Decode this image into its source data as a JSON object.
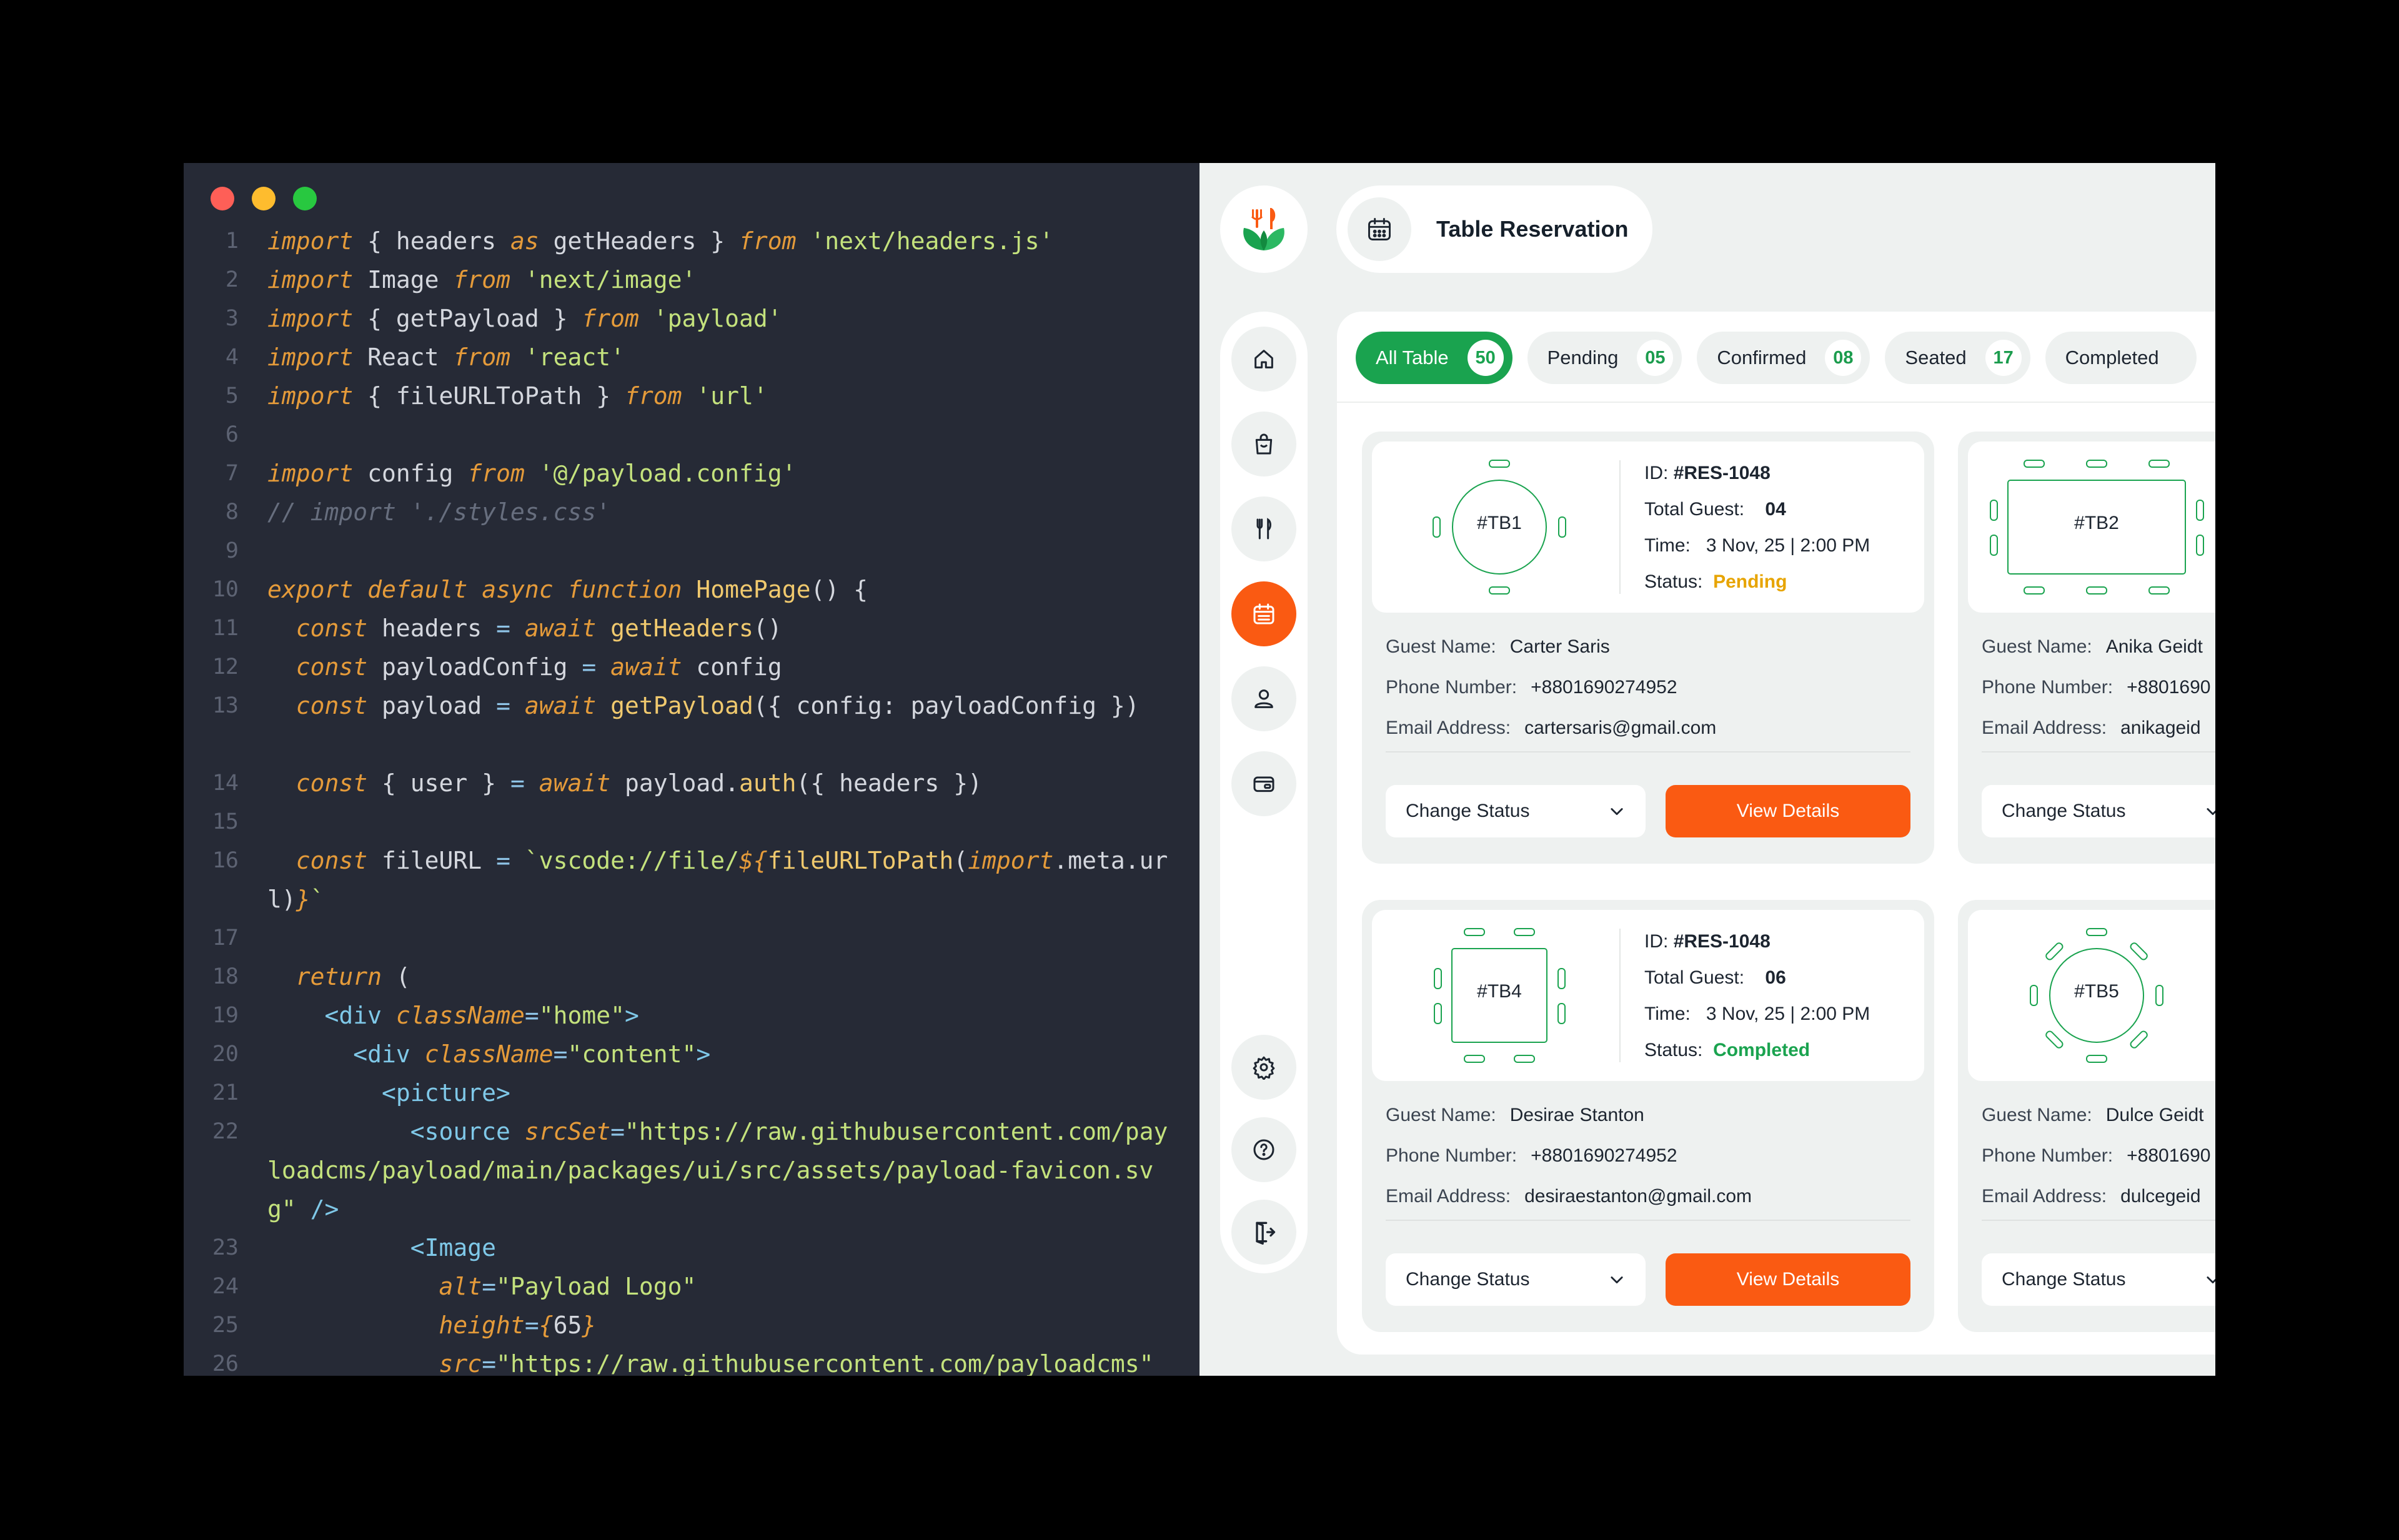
{
  "window_controls": {
    "close_color": "#fe5f57",
    "minimize_color": "#febc2e",
    "maximize_color": "#28c840"
  },
  "editor": {
    "lines": [
      {
        "n": "1",
        "tokens": [
          [
            "kw",
            "import"
          ],
          [
            "p",
            " { headers "
          ],
          [
            "kw",
            "as"
          ],
          [
            "p",
            " getHeaders } "
          ],
          [
            "kw",
            "from"
          ],
          [
            "p",
            " "
          ],
          [
            "str",
            "'next/headers.js'"
          ]
        ]
      },
      {
        "n": "2",
        "tokens": [
          [
            "kw",
            "import"
          ],
          [
            "p",
            " Image "
          ],
          [
            "kw",
            "from"
          ],
          [
            "p",
            " "
          ],
          [
            "str",
            "'next/image'"
          ]
        ]
      },
      {
        "n": "3",
        "tokens": [
          [
            "kw",
            "import"
          ],
          [
            "p",
            " { getPayload } "
          ],
          [
            "kw",
            "from"
          ],
          [
            "p",
            " "
          ],
          [
            "str",
            "'payload'"
          ]
        ]
      },
      {
        "n": "4",
        "tokens": [
          [
            "kw",
            "import"
          ],
          [
            "p",
            " React "
          ],
          [
            "kw",
            "from"
          ],
          [
            "p",
            " "
          ],
          [
            "str",
            "'react'"
          ]
        ]
      },
      {
        "n": "5",
        "tokens": [
          [
            "kw",
            "import"
          ],
          [
            "p",
            " { fileURLToPath } "
          ],
          [
            "kw",
            "from"
          ],
          [
            "p",
            " "
          ],
          [
            "str",
            "'url'"
          ]
        ]
      },
      {
        "n": "6",
        "tokens": []
      },
      {
        "n": "7",
        "tokens": [
          [
            "kw",
            "import"
          ],
          [
            "p",
            " config "
          ],
          [
            "kw",
            "from"
          ],
          [
            "p",
            " "
          ],
          [
            "str",
            "'@/payload.config'"
          ]
        ]
      },
      {
        "n": "8",
        "tokens": [
          [
            "cm",
            "// import './styles.css'"
          ]
        ]
      },
      {
        "n": "9",
        "tokens": []
      },
      {
        "n": "10",
        "tokens": [
          [
            "kw",
            "export"
          ],
          [
            "p",
            " "
          ],
          [
            "kw",
            "default"
          ],
          [
            "p",
            " "
          ],
          [
            "kw",
            "async"
          ],
          [
            "p",
            " "
          ],
          [
            "kw",
            "function"
          ],
          [
            "p",
            " "
          ],
          [
            "fn",
            "HomePage"
          ],
          [
            "p",
            "() {"
          ]
        ]
      },
      {
        "n": "11",
        "tokens": [
          [
            "p",
            "  "
          ],
          [
            "kw",
            "const"
          ],
          [
            "p",
            " headers "
          ],
          [
            "op",
            "="
          ],
          [
            "p",
            " "
          ],
          [
            "kw",
            "await"
          ],
          [
            "p",
            " "
          ],
          [
            "fn",
            "getHeaders"
          ],
          [
            "p",
            "()"
          ]
        ]
      },
      {
        "n": "12",
        "tokens": [
          [
            "p",
            "  "
          ],
          [
            "kw",
            "const"
          ],
          [
            "p",
            " payloadConfig "
          ],
          [
            "op",
            "="
          ],
          [
            "p",
            " "
          ],
          [
            "kw",
            "await"
          ],
          [
            "p",
            " config"
          ]
        ]
      },
      {
        "n": "13",
        "wrap": 2,
        "tokens": [
          [
            "p",
            "  "
          ],
          [
            "kw",
            "const"
          ],
          [
            "p",
            " payload "
          ],
          [
            "op",
            "="
          ],
          [
            "p",
            " "
          ],
          [
            "kw",
            "await"
          ],
          [
            "p",
            " "
          ],
          [
            "fn",
            "getPayload"
          ],
          [
            "p",
            "({ config: payloadConfig })"
          ]
        ]
      },
      {
        "n": "14",
        "tokens": [
          [
            "p",
            "  "
          ],
          [
            "kw",
            "const"
          ],
          [
            "p",
            " { user } "
          ],
          [
            "op",
            "="
          ],
          [
            "p",
            " "
          ],
          [
            "kw",
            "await"
          ],
          [
            "p",
            " payload."
          ],
          [
            "fn",
            "auth"
          ],
          [
            "p",
            "({ headers })"
          ]
        ]
      },
      {
        "n": "15",
        "tokens": []
      },
      {
        "n": "16",
        "wrap": 2,
        "tokens": [
          [
            "p",
            "  "
          ],
          [
            "kw",
            "const"
          ],
          [
            "p",
            " fileURL "
          ],
          [
            "op",
            "="
          ],
          [
            "p",
            " "
          ],
          [
            "str",
            "`vscode://file/"
          ],
          [
            "kw",
            "${"
          ],
          [
            "fn",
            "fileURLToPath"
          ],
          [
            "p",
            "("
          ],
          [
            "kw",
            "import"
          ],
          [
            "p",
            ".meta.url)"
          ],
          [
            "kw",
            "}"
          ],
          [
            "str",
            "`"
          ]
        ]
      },
      {
        "n": "17",
        "tokens": []
      },
      {
        "n": "18",
        "tokens": [
          [
            "p",
            "  "
          ],
          [
            "kw",
            "return"
          ],
          [
            "p",
            " ("
          ]
        ]
      },
      {
        "n": "19",
        "tokens": [
          [
            "p",
            "    "
          ],
          [
            "tag",
            "<div"
          ],
          [
            "p",
            " "
          ],
          [
            "attr",
            "className"
          ],
          [
            "op",
            "="
          ],
          [
            "str",
            "\"home\""
          ],
          [
            "tag",
            ">"
          ]
        ]
      },
      {
        "n": "20",
        "tokens": [
          [
            "p",
            "      "
          ],
          [
            "tag",
            "<div"
          ],
          [
            "p",
            " "
          ],
          [
            "attr",
            "className"
          ],
          [
            "op",
            "="
          ],
          [
            "str",
            "\"content\""
          ],
          [
            "tag",
            ">"
          ]
        ]
      },
      {
        "n": "21",
        "tokens": [
          [
            "p",
            "        "
          ],
          [
            "tag",
            "<picture>"
          ]
        ]
      },
      {
        "n": "22",
        "wrap": 3,
        "tokens": [
          [
            "p",
            "          "
          ],
          [
            "tag",
            "<source"
          ],
          [
            "p",
            " "
          ],
          [
            "attr",
            "srcSet"
          ],
          [
            "op",
            "="
          ],
          [
            "str",
            "\"https://raw.githubusercontent.com/payloadcms/payload/main/packages/ui/src/assets/payload-favicon.svg\""
          ],
          [
            "p",
            " "
          ],
          [
            "tag",
            "/>"
          ]
        ]
      },
      {
        "n": "23",
        "tokens": [
          [
            "p",
            "          "
          ],
          [
            "tag",
            "<Image"
          ]
        ]
      },
      {
        "n": "24",
        "tokens": [
          [
            "p",
            "            "
          ],
          [
            "attr",
            "alt"
          ],
          [
            "op",
            "="
          ],
          [
            "str",
            "\"Payload Logo\""
          ]
        ]
      },
      {
        "n": "25",
        "tokens": [
          [
            "p",
            "            "
          ],
          [
            "attr",
            "height"
          ],
          [
            "op",
            "="
          ],
          [
            "kw",
            "{"
          ],
          [
            "p",
            "65"
          ],
          [
            "kw",
            "}"
          ]
        ]
      },
      {
        "n": "26",
        "tokens": [
          [
            "p",
            "            "
          ],
          [
            "attr",
            "src"
          ],
          [
            "op",
            "="
          ],
          [
            "str",
            "\"https://raw.githubusercontent.com/payloadcms\""
          ]
        ]
      }
    ]
  },
  "app": {
    "page_title": "Table Reservation",
    "accent": "#fa5a12",
    "brand_green": "#1aa34f",
    "sidebar": {
      "top_items": [
        "home-icon",
        "shopping-bag-icon",
        "cutlery-icon",
        "calendar-icon",
        "user-icon",
        "wallet-icon"
      ],
      "active": "calendar-icon",
      "bottom_items": [
        "gear-icon",
        "help-icon",
        "logout-icon"
      ]
    },
    "tabs": [
      {
        "label": "All Table",
        "count": "50",
        "active": true
      },
      {
        "label": "Pending",
        "count": "05"
      },
      {
        "label": "Confirmed",
        "count": "08"
      },
      {
        "label": "Seated",
        "count": "17"
      },
      {
        "label": "Completed",
        "count": ""
      }
    ],
    "labels": {
      "id": "ID:",
      "total_guest": "Total Guest:",
      "time": "Time:",
      "status": "Status:",
      "guest_name": "Guest Name:",
      "phone": "Phone Number:",
      "email": "Email Address:",
      "change_status": "Change Status",
      "view_details": "View Details"
    },
    "cards": [
      {
        "table": "#TB1",
        "shape": "round",
        "id": "#RES-1048",
        "guests": "04",
        "time": "3 Nov, 25 | 2:00 PM",
        "status": "Pending",
        "guest_name": "Carter Saris",
        "phone": "+8801690274952",
        "email": "cartersaris@gmail.com"
      },
      {
        "table": "#TB2",
        "shape": "rect",
        "guest_name": "Anika Geidt",
        "phone": "+8801690",
        "email": "anikageid"
      },
      {
        "table": "#TB4",
        "shape": "square",
        "id": "#RES-1048",
        "guests": "06",
        "time": "3 Nov, 25 | 2:00 PM",
        "status": "Completed",
        "guest_name": "Desirae Stanton",
        "phone": "+8801690274952",
        "email": "desiraestanton@gmail.com"
      },
      {
        "table": "#TB5",
        "shape": "round8",
        "guest_name": "Dulce Geidt",
        "phone": "+8801690",
        "email": "dulcegeid"
      }
    ]
  }
}
